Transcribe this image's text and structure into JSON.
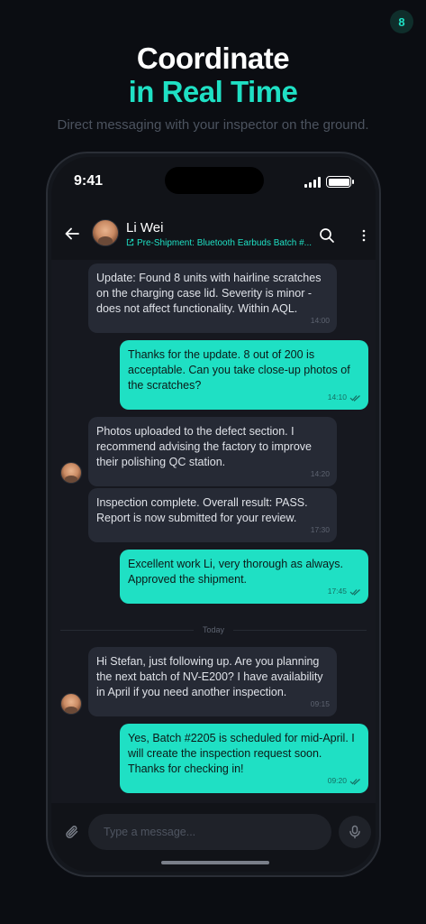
{
  "badge": "8",
  "headline": {
    "line1": "Coordinate",
    "line2": "in Real Time",
    "subtitle": "Direct messaging with your inspector on the ground."
  },
  "status_bar": {
    "time": "9:41"
  },
  "chat_header": {
    "name": "Li Wei",
    "subtitle": "Pre-Shipment: Bluetooth Earbuds Batch #..."
  },
  "messages": [
    {
      "direction": "in",
      "text": "Update: Found 8 units with hairline scratches on the charging case lid. Severity is minor - does not affect functionality. Within AQL.",
      "time": "14:00"
    },
    {
      "direction": "out",
      "text": "Thanks for the update. 8 out of 200 is acceptable. Can you take close-up photos of the scratches?",
      "time": "14:10"
    },
    {
      "direction": "in",
      "text": "Photos uploaded to the defect section. I recommend advising the factory to improve their polishing QC station.",
      "time": "14:20"
    },
    {
      "direction": "in",
      "text": "Inspection complete. Overall result: PASS. Report is now submitted for your review.",
      "time": "17:30"
    },
    {
      "direction": "out",
      "text": "Excellent work Li, very thorough as always. Approved the shipment.",
      "time": "17:45"
    },
    {
      "direction": "in",
      "text": "Hi Stefan, just following up. Are you planning the next batch of NV-E200? I have availability in April if you need another inspection.",
      "time": "09:15"
    },
    {
      "direction": "out",
      "text": "Yes, Batch #2205 is scheduled for mid-April. I will create the inspection request soon. Thanks for checking in!",
      "time": "09:20"
    }
  ],
  "day_divider": "Today",
  "composer": {
    "placeholder": "Type a message..."
  },
  "colors": {
    "accent": "#1fe0c4",
    "background": "#0b0d12",
    "incoming_bubble": "#262a35"
  },
  "icons": [
    "back-arrow-icon",
    "search-icon",
    "more-vertical-icon",
    "link-icon",
    "attach-icon",
    "mic-icon",
    "double-check-icon"
  ]
}
